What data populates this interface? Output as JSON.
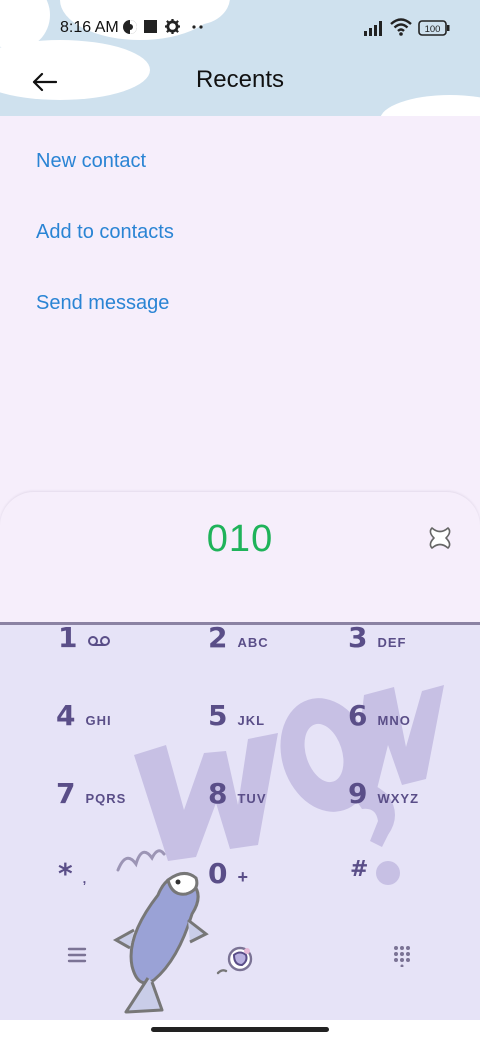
{
  "status_bar": {
    "time": "8:16 AM",
    "battery": "100"
  },
  "header": {
    "title": "Recents"
  },
  "actions": [
    {
      "label": "New contact"
    },
    {
      "label": "Add to contacts"
    },
    {
      "label": "Send message"
    }
  ],
  "dialer": {
    "number": "010"
  },
  "keypad": {
    "keys": [
      {
        "digit": "1",
        "letters": ""
      },
      {
        "digit": "2",
        "letters": "ABC"
      },
      {
        "digit": "3",
        "letters": "DEF"
      },
      {
        "digit": "4",
        "letters": "GHI"
      },
      {
        "digit": "5",
        "letters": "JKL"
      },
      {
        "digit": "6",
        "letters": "MNO"
      },
      {
        "digit": "7",
        "letters": "PQRS"
      },
      {
        "digit": "8",
        "letters": "TUV"
      },
      {
        "digit": "9",
        "letters": "WXYZ"
      },
      {
        "digit": "*",
        "letters": ","
      },
      {
        "digit": "0",
        "letters": "+"
      },
      {
        "digit": "#",
        "letters": ""
      }
    ]
  },
  "colors": {
    "accent_link": "#2a84d4",
    "number_green": "#1fb35a",
    "keypad_text": "#5a4e88",
    "header_bg": "#cfe1ee"
  },
  "icons": [
    "back-arrow-icon",
    "voicemail-icon",
    "clear-icon",
    "menu-icon",
    "call-icon",
    "dialpad-icon",
    "wifi-icon",
    "signal-icon",
    "battery-icon",
    "settings-icon"
  ]
}
